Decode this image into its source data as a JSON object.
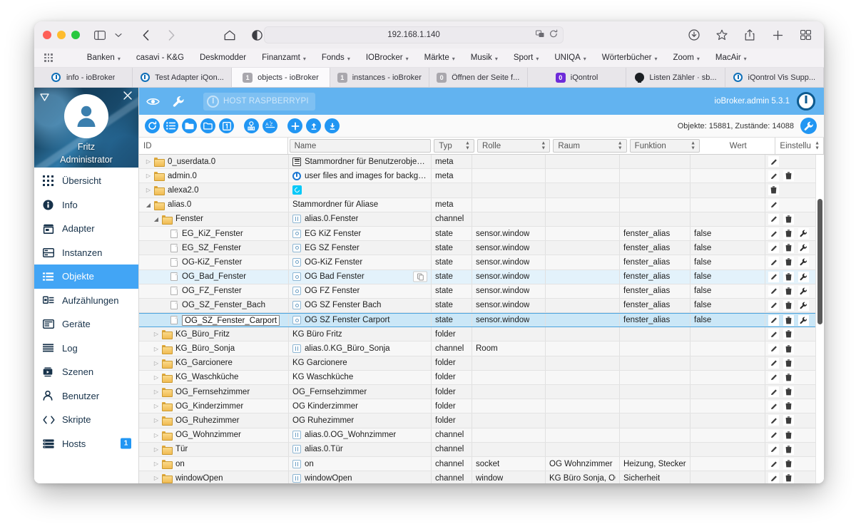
{
  "browser": {
    "url": "192.168.1.140",
    "bookmarks": [
      {
        "label": "Banken",
        "caret": true
      },
      {
        "label": "casavi - K&G",
        "caret": false
      },
      {
        "label": "Deskmodder",
        "caret": false
      },
      {
        "label": "Finanzamt",
        "caret": true
      },
      {
        "label": "Fonds",
        "caret": true
      },
      {
        "label": "IOBrocker",
        "caret": true
      },
      {
        "label": "Märkte",
        "caret": true
      },
      {
        "label": "Musik",
        "caret": true
      },
      {
        "label": "Sport",
        "caret": true
      },
      {
        "label": "UNIQA",
        "caret": true
      },
      {
        "label": "Wörterbücher",
        "caret": true
      },
      {
        "label": "Zoom",
        "caret": true
      },
      {
        "label": "MacAir",
        "caret": true
      }
    ],
    "tabs": [
      {
        "title": "info - ioBroker",
        "favicon": "iobroker-icon",
        "active": false
      },
      {
        "title": "Test Adapter iQon...",
        "favicon": "iobroker-icon",
        "active": false
      },
      {
        "title": "objects - ioBroker",
        "favicon": "badge-1-icon",
        "active": true
      },
      {
        "title": "instances - ioBroker",
        "favicon": "badge-1-icon",
        "active": false
      },
      {
        "title": "Öffnen der Seite f...",
        "favicon": "badge-0-icon",
        "active": false
      },
      {
        "title": "iQontrol",
        "favicon": "badge-0-purple-icon",
        "active": false
      },
      {
        "title": "Listen Zähler · sb...",
        "favicon": "github-icon",
        "active": false
      },
      {
        "title": "iQontrol Vis Supp...",
        "favicon": "iobroker-icon",
        "active": false
      }
    ]
  },
  "drawer": {
    "user_name": "Fritz",
    "user_role": "Administrator",
    "items": [
      {
        "label": "Übersicht",
        "icon": "grid-icon",
        "selected": false,
        "badge": null
      },
      {
        "label": "Info",
        "icon": "info-icon",
        "selected": false,
        "badge": null
      },
      {
        "label": "Adapter",
        "icon": "store-icon",
        "selected": false,
        "badge": null
      },
      {
        "label": "Instanzen",
        "icon": "instances-icon",
        "selected": false,
        "badge": null
      },
      {
        "label": "Objekte",
        "icon": "list-icon",
        "selected": true,
        "badge": null
      },
      {
        "label": "Aufzählungen",
        "icon": "enum-icon",
        "selected": false,
        "badge": null
      },
      {
        "label": "Geräte",
        "icon": "device-icon",
        "selected": false,
        "badge": null
      },
      {
        "label": "Log",
        "icon": "log-icon",
        "selected": false,
        "badge": null
      },
      {
        "label": "Szenen",
        "icon": "scenes-icon",
        "selected": false,
        "badge": null
      },
      {
        "label": "Benutzer",
        "icon": "user-icon",
        "selected": false,
        "badge": null
      },
      {
        "label": "Skripte",
        "icon": "code-icon",
        "selected": false,
        "badge": null
      },
      {
        "label": "Hosts",
        "icon": "hosts-icon",
        "selected": false,
        "badge": "1"
      }
    ]
  },
  "appbar": {
    "host_chip": "HOST RASPBERRYPI",
    "version": "ioBroker.admin 5.3.1"
  },
  "toolbar": {
    "counts": "Objekte: 15881, Zustände: 14088",
    "buttons": [
      "refresh-icon",
      "expand-all-icon",
      "collapse-folder-icon",
      "open-folder-icon",
      "badge-1-icon",
      "filter-custom-icon",
      "sort-az-icon",
      "add-icon",
      "upload-icon",
      "download-icon"
    ]
  },
  "table": {
    "columns": [
      {
        "key": "id",
        "label": "ID",
        "filter": false,
        "sorter": false
      },
      {
        "key": "name",
        "label": "Name",
        "filter": true,
        "sorter": false
      },
      {
        "key": "typ",
        "label": "Typ",
        "filter": true,
        "sorter": true
      },
      {
        "key": "rolle",
        "label": "Rolle",
        "filter": true,
        "sorter": true
      },
      {
        "key": "raum",
        "label": "Raum",
        "filter": true,
        "sorter": true
      },
      {
        "key": "funktion",
        "label": "Funktion",
        "filter": true,
        "sorter": true
      },
      {
        "key": "wert",
        "label": "Wert",
        "filter": false,
        "sorter": false
      },
      {
        "key": "einstellungen",
        "label": "Einstellu",
        "filter": false,
        "sorter": true
      }
    ],
    "rows": [
      {
        "id": "0_userdata.0",
        "indent": 1,
        "expander": "closed",
        "icon": "folder-icon",
        "name": "Stammordner für Benutzerobjekte u...",
        "name_icon": "meta-icon",
        "typ": "meta",
        "rolle": "",
        "raum": "",
        "funktion": "",
        "wert": "",
        "actions": [
          "edit-icon"
        ],
        "state": "normal"
      },
      {
        "id": "admin.0",
        "indent": 1,
        "expander": "closed",
        "icon": "folder-icon",
        "name": "user files and images for background...",
        "name_icon": "iobroker-icon",
        "typ": "meta",
        "rolle": "",
        "raum": "",
        "funktion": "",
        "wert": "",
        "actions": [
          "edit-icon",
          "delete-icon"
        ],
        "state": "normal"
      },
      {
        "id": "alexa2.0",
        "indent": 1,
        "expander": "closed",
        "icon": "folder-icon",
        "name": "",
        "name_icon": "alexa-icon",
        "typ": "",
        "rolle": "",
        "raum": "",
        "funktion": "",
        "wert": "",
        "actions": [
          "delete-icon"
        ],
        "state": "normal"
      },
      {
        "id": "alias.0",
        "indent": 1,
        "expander": "open",
        "icon": "folder-icon",
        "name": "Stammordner für Aliase",
        "name_icon": "none",
        "typ": "meta",
        "rolle": "",
        "raum": "",
        "funktion": "",
        "wert": "",
        "actions": [
          "edit-icon"
        ],
        "state": "normal"
      },
      {
        "id": "Fenster",
        "indent": 2,
        "expander": "open",
        "icon": "folder-icon",
        "name": "alias.0.Fenster",
        "name_icon": "channel-icon",
        "typ": "channel",
        "rolle": "",
        "raum": "",
        "funktion": "",
        "wert": "",
        "actions": [
          "edit-icon",
          "delete-icon"
        ],
        "state": "normal"
      },
      {
        "id": "EG_KiZ_Fenster",
        "indent": 3,
        "expander": "none",
        "icon": "file-icon",
        "name": "EG KiZ Fenster",
        "name_icon": "state-icon",
        "typ": "state",
        "rolle": "sensor.window",
        "raum": "",
        "funktion": "fenster_alias",
        "wert": "false",
        "actions": [
          "edit-icon",
          "delete-icon",
          "wrench-icon"
        ],
        "state": "normal"
      },
      {
        "id": "EG_SZ_Fenster",
        "indent": 3,
        "expander": "none",
        "icon": "file-icon",
        "name": "EG SZ Fenster",
        "name_icon": "state-icon",
        "typ": "state",
        "rolle": "sensor.window",
        "raum": "",
        "funktion": "fenster_alias",
        "wert": "false",
        "actions": [
          "edit-icon",
          "delete-icon",
          "wrench-icon"
        ],
        "state": "normal"
      },
      {
        "id": "OG-KiZ_Fenster",
        "indent": 3,
        "expander": "none",
        "icon": "file-icon",
        "name": "OG-KiZ Fenster",
        "name_icon": "state-icon",
        "typ": "state",
        "rolle": "sensor.window",
        "raum": "",
        "funktion": "fenster_alias",
        "wert": "false",
        "actions": [
          "edit-icon",
          "delete-icon",
          "wrench-icon"
        ],
        "state": "normal"
      },
      {
        "id": "OG_Bad_Fenster",
        "indent": 3,
        "expander": "none",
        "icon": "file-icon",
        "name": "OG Bad Fenster",
        "name_icon": "state-icon",
        "typ": "state",
        "rolle": "sensor.window",
        "raum": "",
        "funktion": "fenster_alias",
        "wert": "false",
        "actions": [
          "edit-icon",
          "delete-icon",
          "wrench-icon"
        ],
        "state": "hovered",
        "copy_badge": true
      },
      {
        "id": "OG_FZ_Fenster",
        "indent": 3,
        "expander": "none",
        "icon": "file-icon",
        "name": "OG FZ Fenster",
        "name_icon": "state-icon",
        "typ": "state",
        "rolle": "sensor.window",
        "raum": "",
        "funktion": "fenster_alias",
        "wert": "false",
        "actions": [
          "edit-icon",
          "delete-icon",
          "wrench-icon"
        ],
        "state": "normal"
      },
      {
        "id": "OG_SZ_Fenster_Bach",
        "indent": 3,
        "expander": "none",
        "icon": "file-icon",
        "name": "OG SZ Fenster Bach",
        "name_icon": "state-icon",
        "typ": "state",
        "rolle": "sensor.window",
        "raum": "",
        "funktion": "fenster_alias",
        "wert": "false",
        "actions": [
          "edit-icon",
          "delete-icon",
          "wrench-icon"
        ],
        "state": "normal"
      },
      {
        "id": "OG_SZ_Fenster_Carport",
        "indent": 3,
        "expander": "none",
        "icon": "file-icon",
        "name": "OG SZ Fenster Carport",
        "name_icon": "state-icon",
        "typ": "state",
        "rolle": "sensor.window",
        "raum": "",
        "funktion": "fenster_alias",
        "wert": "false",
        "actions": [
          "edit-icon",
          "delete-icon",
          "wrench-icon"
        ],
        "state": "selected",
        "editing": true
      },
      {
        "id": "KG_Büro_Fritz",
        "indent": 2,
        "expander": "closed",
        "icon": "folder-icon",
        "name": "KG Büro Fritz",
        "name_icon": "none",
        "typ": "folder",
        "rolle": "",
        "raum": "",
        "funktion": "",
        "wert": "",
        "actions": [
          "edit-icon",
          "delete-icon"
        ],
        "state": "normal"
      },
      {
        "id": "KG_Büro_Sonja",
        "indent": 2,
        "expander": "closed",
        "icon": "folder-icon",
        "name": "alias.0.KG_Büro_Sonja",
        "name_icon": "channel-icon",
        "typ": "channel",
        "rolle": "Room",
        "raum": "",
        "funktion": "",
        "wert": "",
        "actions": [
          "edit-icon",
          "delete-icon"
        ],
        "state": "normal"
      },
      {
        "id": "KG_Garcionere",
        "indent": 2,
        "expander": "closed",
        "icon": "folder-icon",
        "name": "KG Garcionere",
        "name_icon": "none",
        "typ": "folder",
        "rolle": "",
        "raum": "",
        "funktion": "",
        "wert": "",
        "actions": [
          "edit-icon",
          "delete-icon"
        ],
        "state": "normal"
      },
      {
        "id": "KG_Waschküche",
        "indent": 2,
        "expander": "closed",
        "icon": "folder-icon",
        "name": "KG Waschküche",
        "name_icon": "none",
        "typ": "folder",
        "rolle": "",
        "raum": "",
        "funktion": "",
        "wert": "",
        "actions": [
          "edit-icon",
          "delete-icon"
        ],
        "state": "normal"
      },
      {
        "id": "OG_Fernsehzimmer",
        "indent": 2,
        "expander": "closed",
        "icon": "folder-icon",
        "name": "OG_Fernsehzimmer",
        "name_icon": "none",
        "typ": "folder",
        "rolle": "",
        "raum": "",
        "funktion": "",
        "wert": "",
        "actions": [
          "edit-icon",
          "delete-icon"
        ],
        "state": "normal"
      },
      {
        "id": "OG_Kinderzimmer",
        "indent": 2,
        "expander": "closed",
        "icon": "folder-icon",
        "name": "OG Kinderzimmer",
        "name_icon": "none",
        "typ": "folder",
        "rolle": "",
        "raum": "",
        "funktion": "",
        "wert": "",
        "actions": [
          "edit-icon",
          "delete-icon"
        ],
        "state": "normal"
      },
      {
        "id": "OG_Ruhezimmer",
        "indent": 2,
        "expander": "closed",
        "icon": "folder-icon",
        "name": "OG Ruhezimmer",
        "name_icon": "none",
        "typ": "folder",
        "rolle": "",
        "raum": "",
        "funktion": "",
        "wert": "",
        "actions": [
          "edit-icon",
          "delete-icon"
        ],
        "state": "normal"
      },
      {
        "id": "OG_Wohnzimmer",
        "indent": 2,
        "expander": "closed",
        "icon": "folder-icon",
        "name": "alias.0.OG_Wohnzimmer",
        "name_icon": "channel-icon",
        "typ": "channel",
        "rolle": "",
        "raum": "",
        "funktion": "",
        "wert": "",
        "actions": [
          "edit-icon",
          "delete-icon"
        ],
        "state": "normal"
      },
      {
        "id": "Tür",
        "indent": 2,
        "expander": "closed",
        "icon": "folder-icon",
        "name": "alias.0.Tür",
        "name_icon": "channel-icon",
        "typ": "channel",
        "rolle": "",
        "raum": "",
        "funktion": "",
        "wert": "",
        "actions": [
          "edit-icon",
          "delete-icon"
        ],
        "state": "normal"
      },
      {
        "id": "on",
        "indent": 2,
        "expander": "closed",
        "icon": "folder-icon",
        "name": "on",
        "name_icon": "channel-icon",
        "typ": "channel",
        "rolle": "socket",
        "raum": "OG Wohnzimmer",
        "funktion": "Heizung, Stecker",
        "wert": "",
        "actions": [
          "edit-icon",
          "delete-icon"
        ],
        "state": "normal"
      },
      {
        "id": "windowOpen",
        "indent": 2,
        "expander": "closed",
        "icon": "folder-icon",
        "name": "windowOpen",
        "name_icon": "channel-icon",
        "typ": "channel",
        "rolle": "window",
        "raum": "KG Büro Sonja, OG F",
        "funktion": "Sicherheit",
        "wert": "",
        "actions": [
          "edit-icon",
          "delete-icon"
        ],
        "state": "normal"
      }
    ]
  },
  "colors": {
    "accent": "#2196f3",
    "appbar": "#62b3f0",
    "selected_row": "#cbe7f7",
    "hover_row": "#e3f2fb"
  }
}
